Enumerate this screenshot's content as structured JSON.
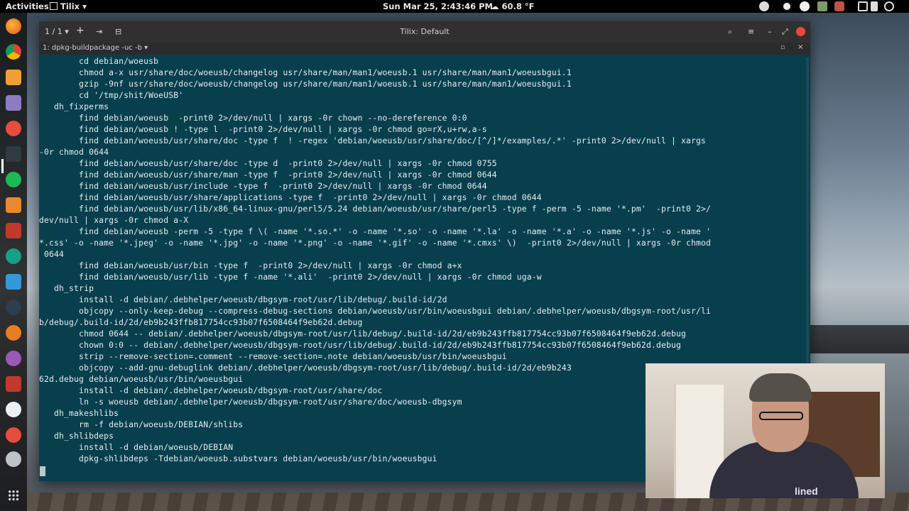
{
  "topbar": {
    "activities": "Activities",
    "app_menu": "Tilix ▾",
    "clock": "Sun Mar 25,  2:43:46 PM",
    "weather": "60.8 °F"
  },
  "window": {
    "session_switcher": "1 / 1 ▾",
    "add_terminal": "+",
    "title": "Tilix: Default",
    "search_icon": "⌕",
    "menu_icon": "≡",
    "minimize": "–",
    "maximize": "⤢"
  },
  "terminal_tab": {
    "label": "1: dpkg-buildpackage -uc -b  ▾",
    "maximize": "▫",
    "close": "×"
  },
  "terminal": {
    "lines": [
      "        cd debian/woeusb",
      "        chmod a-x usr/share/doc/woeusb/changelog usr/share/man/man1/woeusb.1 usr/share/man/man1/woeusbgui.1",
      "        gzip -9nf usr/share/doc/woeusb/changelog usr/share/man/man1/woeusb.1 usr/share/man/man1/woeusbgui.1",
      "        cd '/tmp/shit/WoeUSB'",
      "   dh_fixperms",
      "        find debian/woeusb  -print0 2>/dev/null | xargs -0r chown --no-dereference 0:0",
      "        find debian/woeusb ! -type l  -print0 2>/dev/null | xargs -0r chmod go=rX,u+rw,a-s",
      "        find debian/woeusb/usr/share/doc -type f  ! -regex 'debian/woeusb/usr/share/doc/[^/]*/examples/.*' -print0 2>/dev/null | xargs",
      "-0r chmod 0644",
      "        find debian/woeusb/usr/share/doc -type d  -print0 2>/dev/null | xargs -0r chmod 0755",
      "        find debian/woeusb/usr/share/man -type f  -print0 2>/dev/null | xargs -0r chmod 0644",
      "        find debian/woeusb/usr/include -type f  -print0 2>/dev/null | xargs -0r chmod 0644",
      "        find debian/woeusb/usr/share/applications -type f  -print0 2>/dev/null | xargs -0r chmod 0644",
      "        find debian/woeusb/usr/lib/x86_64-linux-gnu/perl5/5.24 debian/woeusb/usr/share/perl5 -type f -perm -5 -name '*.pm'  -print0 2>/",
      "dev/null | xargs -0r chmod a-X",
      "        find debian/woeusb -perm -5 -type f \\( -name '*.so.*' -o -name '*.so' -o -name '*.la' -o -name '*.a' -o -name '*.js' -o -name '",
      "*.css' -o -name '*.jpeg' -o -name '*.jpg' -o -name '*.png' -o -name '*.gif' -o -name '*.cmxs' \\)  -print0 2>/dev/null | xargs -0r chmod",
      " 0644",
      "        find debian/woeusb/usr/bin -type f  -print0 2>/dev/null | xargs -0r chmod a+x",
      "        find debian/woeusb/usr/lib -type f -name '*.ali'  -print0 2>/dev/null | xargs -0r chmod uga-w",
      "   dh_strip",
      "        install -d debian/.debhelper/woeusb/dbgsym-root/usr/lib/debug/.build-id/2d",
      "        objcopy --only-keep-debug --compress-debug-sections debian/woeusb/usr/bin/woeusbgui debian/.debhelper/woeusb/dbgsym-root/usr/li",
      "b/debug/.build-id/2d/eb9b243ffb817754cc93b07f6508464f9eb62d.debug",
      "        chmod 0644 -- debian/.debhelper/woeusb/dbgsym-root/usr/lib/debug/.build-id/2d/eb9b243ffb817754cc93b07f6508464f9eb62d.debug",
      "        chown 0:0 -- debian/.debhelper/woeusb/dbgsym-root/usr/lib/debug/.build-id/2d/eb9b243ffb817754cc93b07f6508464f9eb62d.debug",
      "        strip --remove-section=.comment --remove-section=.note debian/woeusb/usr/bin/woeusbgui",
      "        objcopy --add-gnu-debuglink debian/.debhelper/woeusb/dbgsym-root/usr/lib/debug/.build-id/2d/eb9b243",
      "62d.debug debian/woeusb/usr/bin/woeusbgui",
      "        install -d debian/.debhelper/woeusb/dbgsym-root/usr/share/doc",
      "        ln -s woeusb debian/.debhelper/woeusb/dbgsym-root/usr/share/doc/woeusb-dbgsym",
      "   dh_makeshlibs",
      "        rm -f debian/woeusb/DEBIAN/shlibs",
      "   dh_shlibdeps",
      "        install -d debian/woeusb/DEBIAN",
      "        dpkg-shlibdeps -Tdebian/woeusb.substvars debian/woeusb/usr/bin/woeusbgui"
    ]
  },
  "webcam": {
    "shirt_text": "lined"
  },
  "colors": {
    "terminal_bg": "#08404e",
    "terminal_fg": "#e6eef0",
    "titlebar_bg": "#303030",
    "close_button": "#e84b3c"
  }
}
